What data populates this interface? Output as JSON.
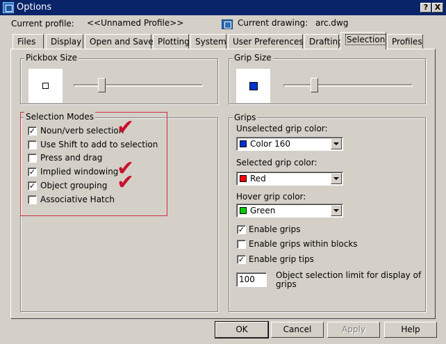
{
  "window": {
    "title": "Options",
    "help_btn": "?",
    "close_btn": "X"
  },
  "header": {
    "current_profile_label": "Current profile:",
    "current_profile_value": "<<Unnamed Profile>>",
    "current_drawing_label": "Current drawing:",
    "current_drawing_value": "arc.dwg"
  },
  "tabs": [
    {
      "label": "Files"
    },
    {
      "label": "Display"
    },
    {
      "label": "Open and Save"
    },
    {
      "label": "Plotting"
    },
    {
      "label": "System"
    },
    {
      "label": "User Preferences"
    },
    {
      "label": "Drafting"
    },
    {
      "label": "Selection",
      "active": true
    },
    {
      "label": "Profiles"
    }
  ],
  "pickbox": {
    "title": "Pickbox Size",
    "slider_level": 0.2
  },
  "grip_size": {
    "title": "Grip Size",
    "slider_level": 0.22,
    "preview_color": "#0033cc"
  },
  "selection_modes": {
    "title": "Selection Modes",
    "items": [
      {
        "label": "Noun/verb selection",
        "checked": true,
        "annotated": true
      },
      {
        "label": "Use Shift to add to selection",
        "checked": false,
        "annotated": false
      },
      {
        "label": "Press and drag",
        "checked": false,
        "annotated": false
      },
      {
        "label": "Implied windowing",
        "checked": true,
        "annotated": true
      },
      {
        "label": "Object grouping",
        "checked": true,
        "annotated": true
      },
      {
        "label": "Associative Hatch",
        "checked": false,
        "annotated": false
      }
    ]
  },
  "grips": {
    "title": "Grips",
    "unselected_label": "Unselected grip color:",
    "unselected_value": "Color 160",
    "unselected_color": "#0033cc",
    "selected_label": "Selected grip color:",
    "selected_value": "Red",
    "selected_color": "#ff0000",
    "hover_label": "Hover grip color:",
    "hover_value": "Green",
    "hover_color": "#00cc00",
    "enable_grips": {
      "label": "Enable grips",
      "checked": true
    },
    "enable_grips_blocks": {
      "label": "Enable grips within blocks",
      "checked": false
    },
    "enable_grip_tips": {
      "label": "Enable grip tips",
      "checked": true
    },
    "limit_value": "100",
    "limit_label": "Object selection limit for display of grips"
  },
  "buttons": {
    "ok": "OK",
    "cancel": "Cancel",
    "apply": "Apply",
    "help": "Help"
  },
  "annotation_color": "#c8102e",
  "check_glyph": "✔"
}
